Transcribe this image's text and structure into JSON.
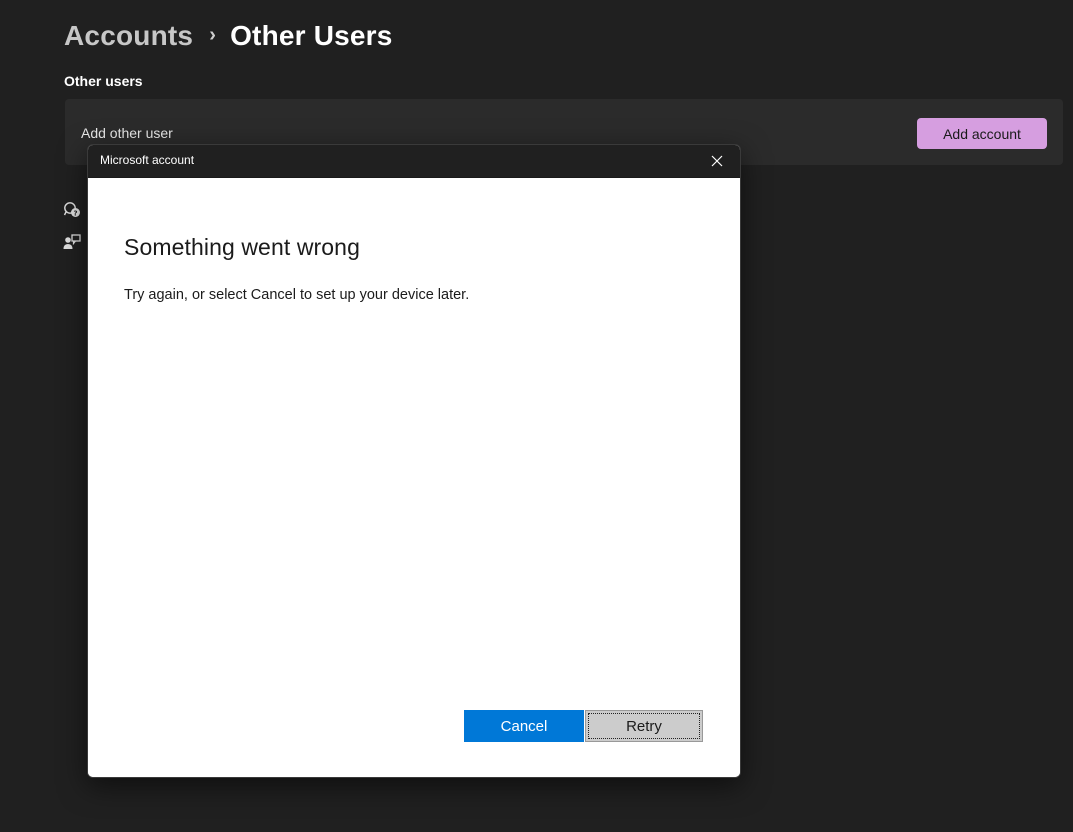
{
  "breadcrumb": {
    "parent": "Accounts",
    "separator": "›",
    "current": "Other Users"
  },
  "section": {
    "title": "Other users"
  },
  "add_user_card": {
    "label": "Add other user",
    "button_label": "Add account",
    "button_color": "#d69ee0"
  },
  "side_icons": [
    "help-icon",
    "feedback-icon"
  ],
  "dialog": {
    "title": "Microsoft account",
    "close_icon": "close-icon",
    "heading": "Something went wrong",
    "message": "Try again, or select Cancel to set up your device later.",
    "cancel_label": "Cancel",
    "retry_label": "Retry",
    "accent_color": "#0078d7"
  }
}
